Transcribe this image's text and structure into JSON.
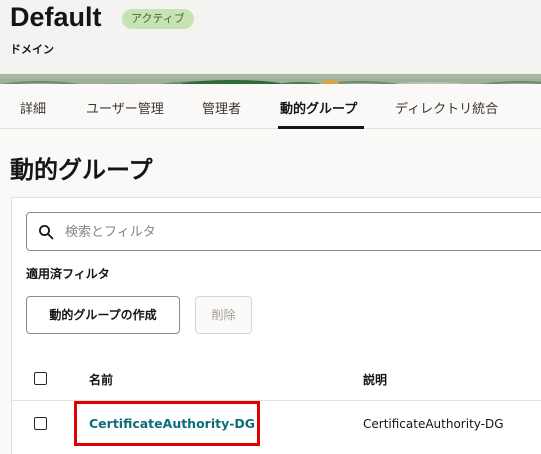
{
  "domain": {
    "title": "Default",
    "status_badge": "アクティブ",
    "subtitle": "ドメイン"
  },
  "tabs": [
    {
      "label": "詳細",
      "active": false
    },
    {
      "label": "ユーザー管理",
      "active": false
    },
    {
      "label": "管理者",
      "active": false
    },
    {
      "label": "動的グループ",
      "active": true
    },
    {
      "label": "ディレクトリ統合",
      "active": false
    }
  ],
  "page": {
    "title": "動的グループ"
  },
  "search": {
    "placeholder": "検索とフィルタ",
    "value": ""
  },
  "filters": {
    "applied_label": "適用済フィルタ"
  },
  "toolbar": {
    "create_label": "動的グループの作成",
    "delete_label": "削除"
  },
  "table": {
    "columns": [
      "名前",
      "説明"
    ],
    "rows": [
      {
        "name": "CertificateAuthority-DG",
        "description": "CertificateAuthority-DG",
        "checked": false,
        "highlighted": true
      }
    ]
  },
  "colors": {
    "badge_bg": "#c7e3b4",
    "link": "#0d6e7a",
    "highlight": "#e00000",
    "active_tab_underline": "#161513"
  }
}
